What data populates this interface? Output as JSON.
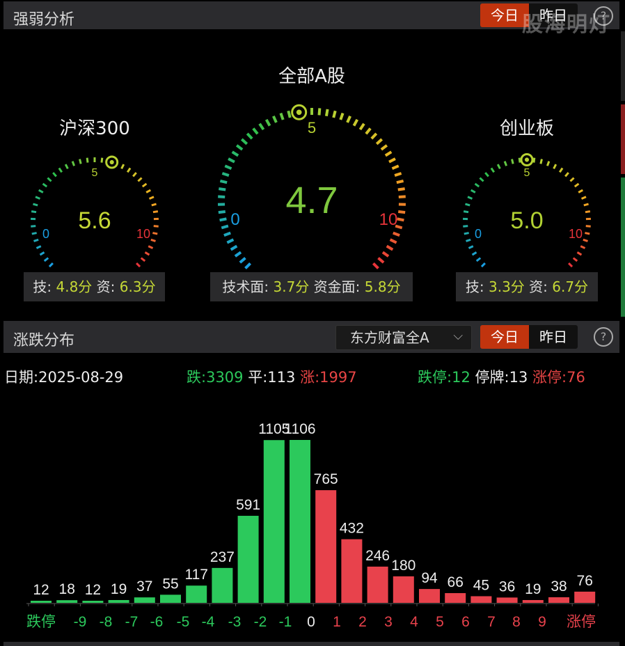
{
  "watermark": "股海明灯",
  "strength": {
    "title": "强弱分析",
    "tabs": {
      "today": "今日",
      "yesterday": "昨日"
    },
    "help": "?",
    "gauges": [
      {
        "name": "沪深300",
        "value": 5.6,
        "value_text": "5.6",
        "min": "0",
        "mid": "5",
        "max": "10",
        "tech_label": "技:",
        "tech": "4.8分",
        "fund_label": "资:",
        "fund": "6.3分",
        "value_color": "#c6d936"
      },
      {
        "name": "全部A股",
        "value": 4.7,
        "value_text": "4.7",
        "min": "0",
        "mid": "5",
        "max": "10",
        "tech_label": "技术面:",
        "tech": "3.7分",
        "fund_label": "资金面:",
        "fund": "5.8分",
        "value_color": "#7fc83e"
      },
      {
        "name": "创业板",
        "value": 5.0,
        "value_text": "5.0",
        "min": "0",
        "mid": "5",
        "max": "10",
        "tech_label": "技:",
        "tech": "3.3分",
        "fund_label": "资:",
        "fund": "6.7分",
        "value_color": "#b2d233"
      }
    ]
  },
  "distribution": {
    "title": "涨跌分布",
    "dropdown": "东方财富全A",
    "tabs": {
      "today": "今日",
      "yesterday": "昨日"
    },
    "help": "?",
    "date_label": "日期:",
    "date": "2025-08-29",
    "down_label": "跌:",
    "down": "3309",
    "flat_label": "平:",
    "flat": "113",
    "up_label": "涨:",
    "up": "1997",
    "limit_down_label": "跌停:",
    "limit_down": "12",
    "suspended_label": "停牌:",
    "suspended": "13",
    "limit_up_label": "涨停:",
    "limit_up": "76"
  },
  "chart_data": {
    "type": "bar",
    "categories": [
      "跌停",
      "-9",
      "-8",
      "-7",
      "-6",
      "-5",
      "-4",
      "-3",
      "-2",
      "-1",
      "0",
      "1",
      "2",
      "3",
      "4",
      "5",
      "6",
      "7",
      "8",
      "9",
      "涨停"
    ],
    "values": [
      12,
      18,
      12,
      19,
      37,
      55,
      117,
      237,
      591,
      1105,
      1106,
      765,
      432,
      246,
      180,
      94,
      66,
      45,
      36,
      19,
      38,
      76
    ],
    "bars": [
      {
        "label": "跌停",
        "value": 12,
        "color": "#2cc95c"
      },
      {
        "label": "-9",
        "value": 18,
        "color": "#2cc95c"
      },
      {
        "label": "-8",
        "value": 12,
        "color": "#2cc95c"
      },
      {
        "label": "-7",
        "value": 19,
        "color": "#2cc95c"
      },
      {
        "label": "-6",
        "value": 37,
        "color": "#2cc95c"
      },
      {
        "label": "-5",
        "value": 55,
        "color": "#2cc95c"
      },
      {
        "label": "-4",
        "value": 117,
        "color": "#2cc95c"
      },
      {
        "label": "-3",
        "value": 237,
        "color": "#2cc95c"
      },
      {
        "label": "-2",
        "value": 591,
        "color": "#2cc95c"
      },
      {
        "label": "-1",
        "value": 1105,
        "color": "#2cc95c"
      },
      {
        "label": "0",
        "value": 1106,
        "color": "#2cc95c"
      },
      {
        "label": "1",
        "value": 765,
        "color": "#e8424c"
      },
      {
        "label": "2",
        "value": 432,
        "color": "#e8424c"
      },
      {
        "label": "3",
        "value": 246,
        "color": "#e8424c"
      },
      {
        "label": "4",
        "value": 180,
        "color": "#e8424c"
      },
      {
        "label": "5",
        "value": 94,
        "color": "#e8424c"
      },
      {
        "label": "6",
        "value": 66,
        "color": "#e8424c"
      },
      {
        "label": "7",
        "value": 45,
        "color": "#e8424c"
      },
      {
        "label": "8",
        "value": 36,
        "color": "#e8424c"
      },
      {
        "label": "9",
        "value": 19,
        "color": "#e8424c"
      },
      {
        "label": "涨停",
        "value": 38,
        "color": "#e8424c"
      },
      {
        "label": "",
        "value": 76,
        "color": "#e8424c"
      }
    ],
    "axis_labels": [
      {
        "text": "跌停",
        "color": "#2cc95c"
      },
      {
        "text": "-9",
        "color": "#2cc95c"
      },
      {
        "text": "-8",
        "color": "#2cc95c"
      },
      {
        "text": "-7",
        "color": "#2cc95c"
      },
      {
        "text": "-6",
        "color": "#2cc95c"
      },
      {
        "text": "-5",
        "color": "#2cc95c"
      },
      {
        "text": "-4",
        "color": "#2cc95c"
      },
      {
        "text": "-3",
        "color": "#2cc95c"
      },
      {
        "text": "-2",
        "color": "#2cc95c"
      },
      {
        "text": "-1",
        "color": "#2cc95c"
      },
      {
        "text": "0",
        "color": "#eeeeee"
      },
      {
        "text": "1",
        "color": "#e8424c"
      },
      {
        "text": "2",
        "color": "#e8424c"
      },
      {
        "text": "3",
        "color": "#e8424c"
      },
      {
        "text": "4",
        "color": "#e8424c"
      },
      {
        "text": "5",
        "color": "#e8424c"
      },
      {
        "text": "6",
        "color": "#e8424c"
      },
      {
        "text": "7",
        "color": "#e8424c"
      },
      {
        "text": "8",
        "color": "#e8424c"
      },
      {
        "text": "9",
        "color": "#e8424c"
      },
      {
        "text": "涨停",
        "color": "#e8424c"
      }
    ],
    "ylim": [
      0,
      1106
    ],
    "grid": false
  },
  "colors": {
    "accent": "#c1340e",
    "up": "#e8424c",
    "down": "#2cc95c"
  }
}
